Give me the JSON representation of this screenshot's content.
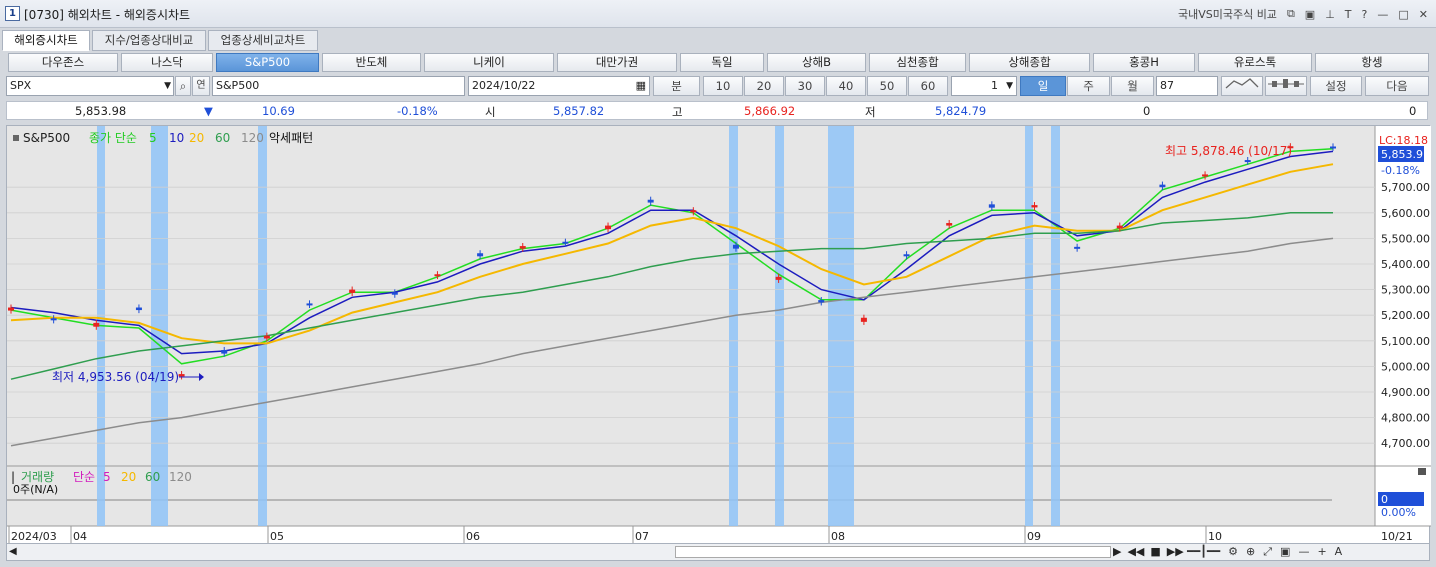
{
  "window": {
    "number": "1",
    "title": "[0730] 해외차트 - 해외증시차트",
    "compare_label": "국내VS미국주식 비교"
  },
  "tabs": [
    {
      "label": "해외증시차트",
      "active": true
    },
    {
      "label": "지수/업종상대비교",
      "active": false
    },
    {
      "label": "업종상세비교차트",
      "active": false
    }
  ],
  "markets": [
    {
      "label": "다우존스",
      "selected": false
    },
    {
      "label": "나스닥",
      "selected": false
    },
    {
      "label": "S&P500",
      "selected": true
    },
    {
      "label": "반도체",
      "selected": false
    },
    {
      "label": "니케이",
      "selected": false
    },
    {
      "label": "대만가권",
      "selected": false
    },
    {
      "label": "독일",
      "selected": false
    },
    {
      "label": "상해B",
      "selected": false
    },
    {
      "label": "심천종합",
      "selected": false
    },
    {
      "label": "상해종합",
      "selected": false
    },
    {
      "label": "홍콩H",
      "selected": false
    },
    {
      "label": "유로스톡",
      "selected": false
    },
    {
      "label": "항셍",
      "selected": false
    }
  ],
  "toolbar": {
    "symbol_code": "SPX",
    "symbol_name": "S&P500",
    "date": "2024/10/22",
    "unit_label": "분",
    "minute_options": [
      "10",
      "20",
      "30",
      "40",
      "50",
      "60"
    ],
    "period_count": "1",
    "periods": [
      {
        "label": "일",
        "selected": true
      },
      {
        "label": "주",
        "selected": false
      },
      {
        "label": "월",
        "selected": false
      }
    ],
    "bar_count": "87",
    "settings_label": "설정",
    "next_label": "다음",
    "connect_label": "연"
  },
  "info": {
    "price": "5,853.98",
    "change_arrow": "▼",
    "change": "10.69",
    "change_pct": "-0.18%",
    "open_label": "시",
    "open": "5,857.82",
    "high_label": "고",
    "high": "5,866.92",
    "low_label": "저",
    "low": "5,824.79",
    "volume": "0",
    "value": "0"
  },
  "chart": {
    "legend_symbol": "S&P500",
    "legend_type": "종가 단순",
    "ma_periods": [
      "5",
      "10",
      "20",
      "60",
      "120"
    ],
    "pattern_label": "악세패턴",
    "high_annotation": "최고 5,878.46 (10/17)",
    "low_annotation": "최저 4,953.56 (04/19)",
    "current_price_tag": "5,853.9",
    "lc_tag": "LC:18.18",
    "change_pct_tag": "-0.18%",
    "volume_legend": {
      "label": "거래량",
      "type": "단순",
      "periods": [
        "5",
        "20",
        "60",
        "120"
      ]
    },
    "volume_value": "0주(N/A)",
    "volume_tag": "0",
    "volume_pct": "0.00%",
    "date_labels": [
      "2024/03",
      "04",
      "05",
      "06",
      "07",
      "08",
      "09",
      "10"
    ],
    "last_date": "10/21",
    "colors": {
      "up": "#e8231f",
      "down": "#1f4fd8",
      "ma5": "#22dd22",
      "ma10": "#1c1cbf",
      "ma20": "#f5b800",
      "ma60": "#2f9e4f",
      "ma120": "#8c8c8c",
      "highlight": "#8fc3f7"
    }
  },
  "chart_data": {
    "type": "candlestick",
    "y_ticks": [
      "5,700.00",
      "5,600.00",
      "5,500.00",
      "5,400.00",
      "5,300.00",
      "5,200.00",
      "5,100.00",
      "5,000.00",
      "4,900.00",
      "4,800.00",
      "4,700.00"
    ],
    "ylim": [
      4650,
      5900
    ],
    "x": [
      "2024-03",
      "2024-04",
      "2024-05",
      "2024-06",
      "2024-07",
      "2024-08",
      "2024-09",
      "2024-10"
    ],
    "series": [
      {
        "name": "S&P500",
        "close_approx": [
          5230,
          5180,
          5170,
          5220,
          4970,
          5050,
          5120,
          5240,
          5300,
          5280,
          5360,
          5430,
          5470,
          5480,
          5550,
          5640,
          5610,
          5460,
          5350,
          5250,
          5190,
          5430,
          5560,
          5620,
          5630,
          5460,
          5550,
          5700,
          5750,
          5800,
          5860,
          5854
        ]
      },
      {
        "name": "5",
        "values_approx": [
          5220,
          5190,
          5160,
          5150,
          5010,
          5040,
          5100,
          5220,
          5290,
          5290,
          5350,
          5420,
          5460,
          5480,
          5540,
          5630,
          5600,
          5480,
          5360,
          5260,
          5260,
          5420,
          5540,
          5610,
          5610,
          5490,
          5540,
          5690,
          5740,
          5790,
          5840,
          5850
        ]
      },
      {
        "name": "10",
        "values_approx": [
          5230,
          5210,
          5180,
          5160,
          5050,
          5060,
          5090,
          5190,
          5270,
          5290,
          5330,
          5400,
          5450,
          5470,
          5520,
          5610,
          5610,
          5510,
          5400,
          5300,
          5260,
          5380,
          5510,
          5590,
          5600,
          5510,
          5530,
          5660,
          5720,
          5770,
          5820,
          5840
        ]
      },
      {
        "name": "20",
        "values_approx": [
          5180,
          5190,
          5190,
          5170,
          5110,
          5090,
          5090,
          5140,
          5210,
          5250,
          5290,
          5350,
          5400,
          5440,
          5480,
          5550,
          5580,
          5540,
          5470,
          5380,
          5320,
          5350,
          5430,
          5510,
          5550,
          5530,
          5530,
          5610,
          5660,
          5710,
          5760,
          5790
        ]
      },
      {
        "name": "60",
        "values_approx": [
          4950,
          4990,
          5030,
          5060,
          5080,
          5100,
          5120,
          5150,
          5180,
          5210,
          5240,
          5270,
          5290,
          5320,
          5350,
          5390,
          5420,
          5440,
          5450,
          5460,
          5460,
          5480,
          5490,
          5500,
          5520,
          5520,
          5530,
          5560,
          5570,
          5580,
          5600,
          5600
        ]
      },
      {
        "name": "120",
        "values_approx": [
          4690,
          4720,
          4750,
          4780,
          4800,
          4830,
          4860,
          4890,
          4920,
          4950,
          4980,
          5010,
          5050,
          5080,
          5110,
          5140,
          5170,
          5200,
          5220,
          5250,
          5270,
          5290,
          5310,
          5330,
          5350,
          5370,
          5390,
          5410,
          5430,
          5450,
          5480,
          5500
        ]
      }
    ]
  }
}
